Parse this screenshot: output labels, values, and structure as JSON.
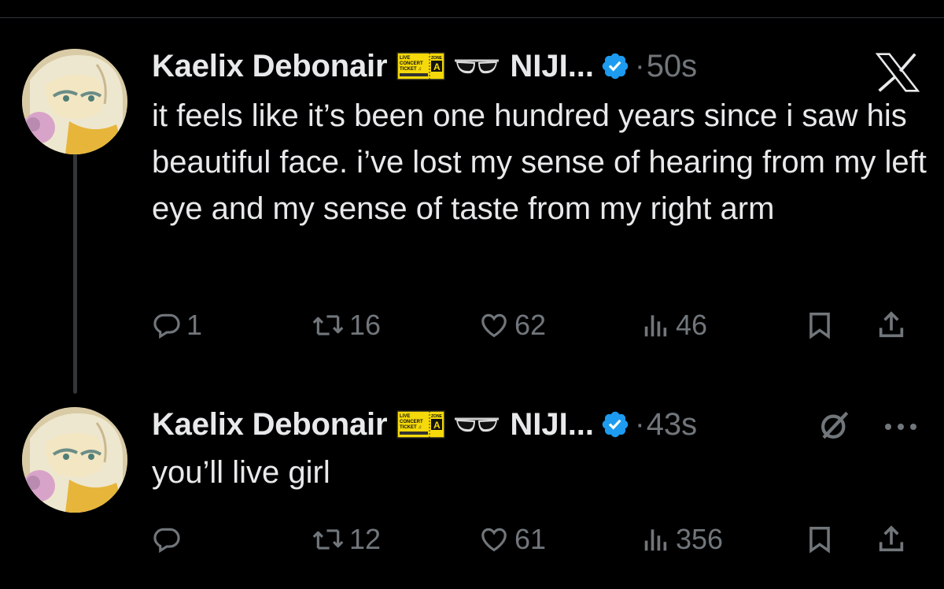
{
  "tweets": [
    {
      "display_name": "Kaelix Debonair",
      "org": "NIJI...",
      "time": "50s",
      "text": "it feels like it’s been one hundred years since i saw his beautiful face. i’ve lost my sense of hearing from my left eye and my sense of taste from my right arm",
      "counts": {
        "reply": "1",
        "repost": "16",
        "like": "62",
        "views": "46"
      },
      "ticket": {
        "line1": "LIVE",
        "line2": "CONCERT",
        "line3": "TICKET ♫",
        "zone": "ZONE",
        "zone_letter": "A"
      }
    },
    {
      "display_name": "Kaelix Debonair",
      "org": "NIJI...",
      "time": "43s",
      "text": "you’ll live girl",
      "counts": {
        "reply": "",
        "repost": "12",
        "like": "61",
        "views": "356"
      },
      "ticket": {
        "line1": "LIVE",
        "line2": "CONCERT",
        "line3": "TICKET ♫",
        "zone": "ZONE",
        "zone_letter": "A"
      }
    }
  ],
  "separator": "·",
  "colors": {
    "background": "#000000",
    "text": "#e7e9ea",
    "muted": "#71767b",
    "verified": "#1d9bf0",
    "thread_line": "#333639",
    "ticket_yellow": "#f5d90a"
  },
  "icons": [
    "x-logo-icon",
    "verified-badge-icon",
    "reply-icon",
    "repost-icon",
    "like-icon",
    "views-icon",
    "bookmark-icon",
    "share-icon",
    "grok-slash-icon",
    "more-icon"
  ]
}
